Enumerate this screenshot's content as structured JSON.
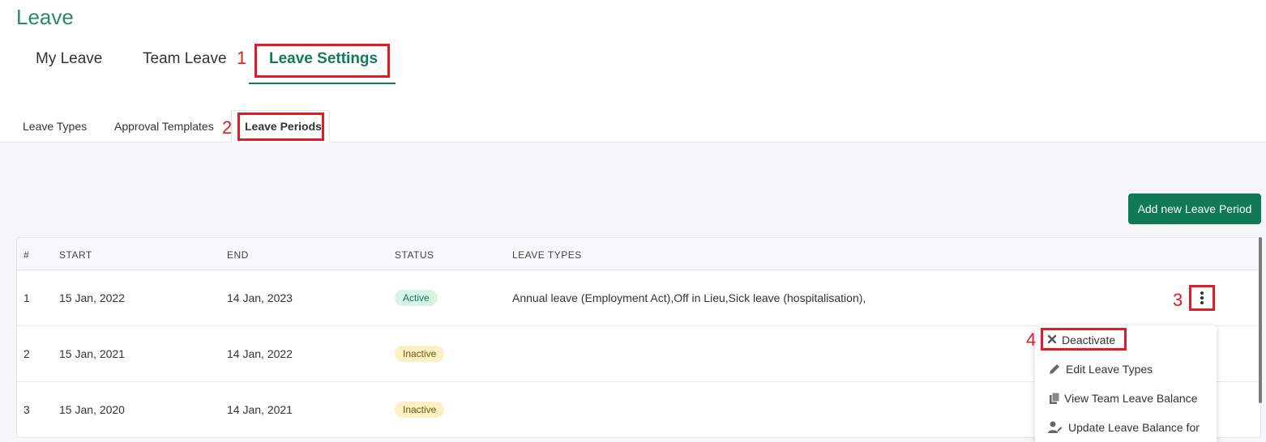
{
  "page": {
    "title": "Leave"
  },
  "main_tabs": [
    {
      "label": "My Leave"
    },
    {
      "label": "Team Leave"
    },
    {
      "label": "Leave Settings"
    }
  ],
  "sub_tabs": [
    {
      "label": "Leave Types"
    },
    {
      "label": "Approval Templates"
    },
    {
      "label": "Leave Periods"
    }
  ],
  "actions": {
    "add_label": "Add new Leave Period"
  },
  "table": {
    "headers": [
      "#",
      "START",
      "END",
      "STATUS",
      "LEAVE TYPES"
    ],
    "rows": [
      {
        "num": "1",
        "start": "15 Jan, 2022",
        "end": "14 Jan, 2023",
        "status": "Active",
        "types": "Annual leave (Employment Act),Off in Lieu,Sick leave (hospitalisation),"
      },
      {
        "num": "2",
        "start": "15 Jan, 2021",
        "end": "14 Jan, 2022",
        "status": "Inactive",
        "types": ""
      },
      {
        "num": "3",
        "start": "15 Jan, 2020",
        "end": "14 Jan, 2021",
        "status": "Inactive",
        "types": ""
      }
    ]
  },
  "menu": {
    "items": [
      {
        "label": "Deactivate",
        "icon": "close-icon"
      },
      {
        "label": "Edit Leave Types",
        "icon": "pencil-icon"
      },
      {
        "label": "View Team Leave Balance",
        "icon": "copy-icon"
      },
      {
        "label": "Update Leave Balance for",
        "icon": "user-edit-icon"
      }
    ]
  },
  "annotations": [
    "1",
    "2",
    "3",
    "4"
  ],
  "colors": {
    "brand": "#13795b",
    "button": "#0f7a55",
    "annotation": "#e01b24"
  }
}
